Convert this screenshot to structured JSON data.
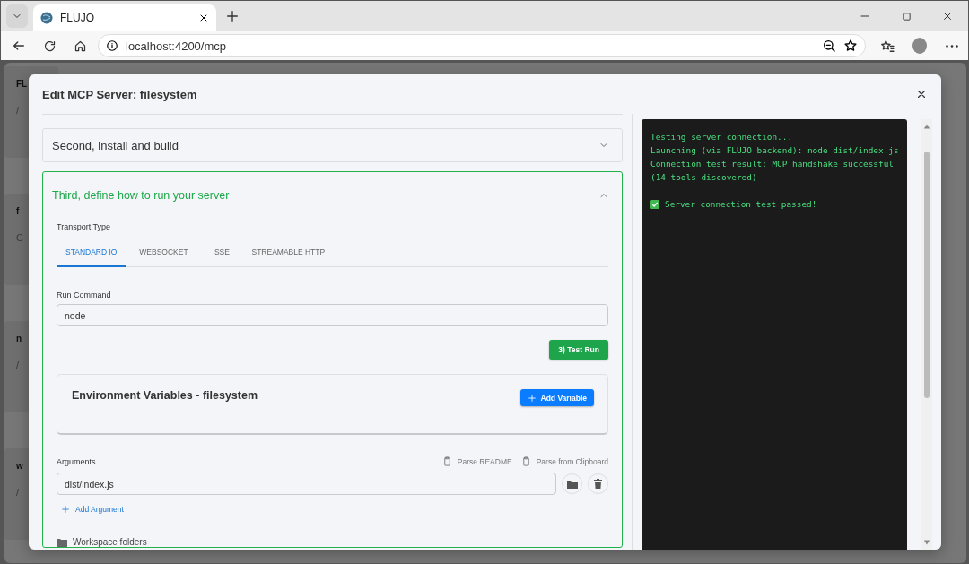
{
  "browser": {
    "tab_title": "FLUJO",
    "url": "localhost:4200/mcp"
  },
  "background_page": {
    "cards": [
      {
        "title": "FL",
        "subtitle": "/"
      },
      {
        "title": "f",
        "subtitle": "C"
      },
      {
        "title": "n",
        "subtitle": "/"
      },
      {
        "title": "w",
        "subtitle": "/"
      }
    ]
  },
  "modal": {
    "title": "Edit MCP Server: filesystem",
    "accordions": [
      {
        "title": "Second, install and build",
        "expanded": false
      },
      {
        "title": "Third, define how to run your server",
        "expanded": true
      }
    ],
    "transport": {
      "label": "Transport Type",
      "tabs": [
        {
          "label": "STANDARD IO",
          "selected": true
        },
        {
          "label": "WEBSOCKET",
          "selected": false
        },
        {
          "label": "SSE",
          "selected": false
        },
        {
          "label": "STREAMABLE HTTP",
          "selected": false
        }
      ]
    },
    "run_command": {
      "label": "Run Command",
      "value": "node"
    },
    "test_button": "3) Test Run",
    "env_card": {
      "title": "Environment Variables - filesystem",
      "add_button": "Add Variable"
    },
    "arguments": {
      "label": "Arguments",
      "actions": [
        "Parse README",
        "Parse from Clipboard"
      ],
      "values": [
        "dist/index.js"
      ],
      "add_link": "Add Argument"
    },
    "workspace": "Workspace folders",
    "terminal": {
      "lines": [
        "Testing server connection...",
        "Launching (via FLUJO backend): node dist/index.js",
        "Connection test result: MCP handshake successful",
        "(14 tools discovered)"
      ],
      "result": "Server connection test passed!"
    }
  }
}
